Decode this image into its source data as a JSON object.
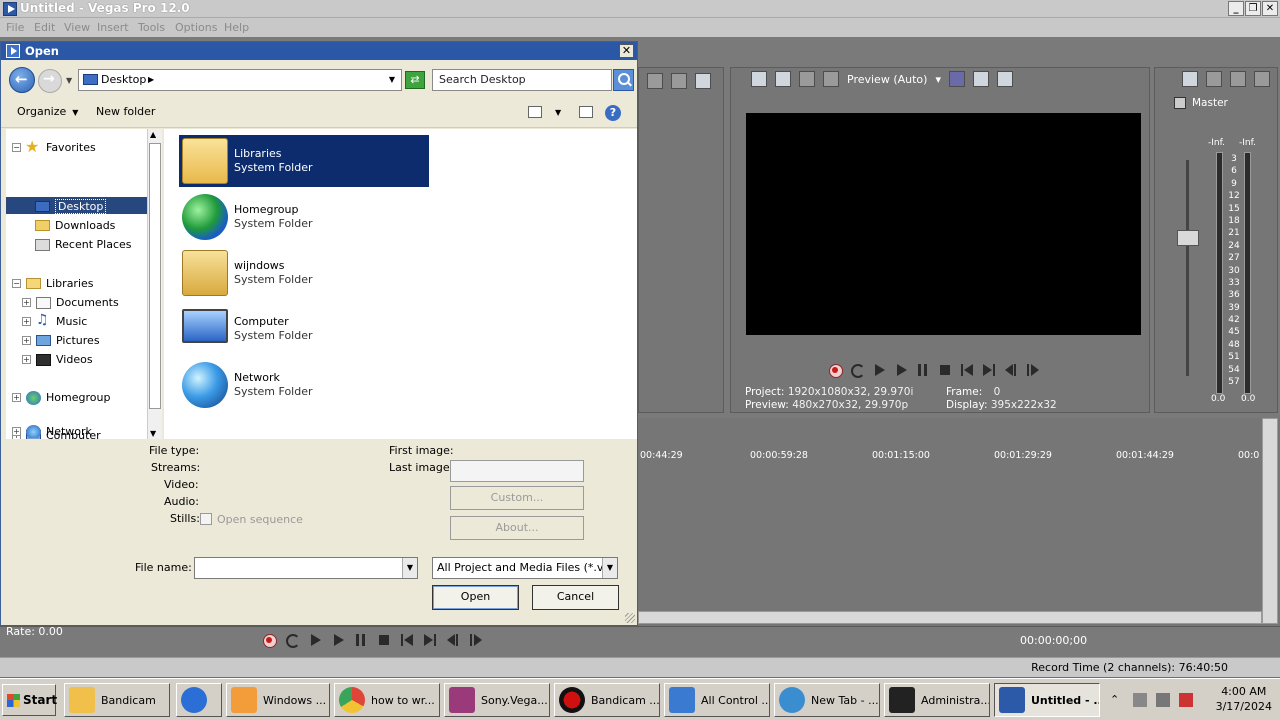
{
  "window": {
    "title": "Untitled - Vegas Pro 12.0"
  },
  "menu": [
    "File",
    "Edit",
    "View",
    "Insert",
    "Tools",
    "Options",
    "Help"
  ],
  "dialog": {
    "title": "Open",
    "address": "Desktop",
    "search_placeholder": "Search Desktop",
    "organize": "Organize",
    "new_folder": "New folder",
    "nav_tree": {
      "favorites": "Favorites",
      "desktop": "Desktop",
      "downloads": "Downloads",
      "recent_places": "Recent Places",
      "libraries": "Libraries",
      "documents": "Documents",
      "music": "Music",
      "pictures": "Pictures",
      "videos": "Videos",
      "homegroup": "Homegroup",
      "computer": "Computer",
      "network": "Network"
    },
    "items": [
      {
        "name": "Libraries",
        "type": "System Folder"
      },
      {
        "name": "Homegroup",
        "type": "System Folder"
      },
      {
        "name": "wijndows",
        "type": "System Folder"
      },
      {
        "name": "Computer",
        "type": "System Folder"
      },
      {
        "name": "Network",
        "type": "System Folder"
      }
    ],
    "details": {
      "file_type": "File type:",
      "streams": "Streams:",
      "video": "Video:",
      "audio": "Audio:",
      "stills": "Stills:",
      "open_sequence": "Open sequence",
      "first_image": "First image:",
      "last_image": "Last image:",
      "custom": "Custom...",
      "about": "About..."
    },
    "file_name_label": "File name:",
    "file_name_value": "",
    "filter": "All Project and Media Files (*.veg",
    "open_button": "Open",
    "cancel_button": "Cancel"
  },
  "preview": {
    "mode": "Preview (Auto)",
    "project_label": "Project:",
    "project_value": "1920x1080x32, 29.970i",
    "preview_label": "Preview:",
    "preview_value": "480x270x32, 29.970p",
    "frame_label": "Frame:",
    "frame_value": "0",
    "display_label": "Display:",
    "display_value": "395x222x32"
  },
  "master": {
    "label": "Master",
    "left_peak": "-Inf.",
    "right_peak": "-Inf.",
    "scale": [
      "3",
      "6",
      "9",
      "12",
      "15",
      "18",
      "21",
      "24",
      "27",
      "30",
      "33",
      "36",
      "39",
      "42",
      "45",
      "48",
      "51",
      "54",
      "57"
    ],
    "left_bottom": "0.0",
    "right_bottom": "0.0"
  },
  "timeline": {
    "ticks": [
      "00:44:29",
      "00:00:59:28",
      "00:01:15:00",
      "00:01:29:29",
      "00:01:44:29",
      "00:0"
    ]
  },
  "rate": "Rate: 0.00",
  "timecode": "00:00:00;00",
  "record_time": "Record Time (2 channels): 76:40:50",
  "taskbar": {
    "start": "Start",
    "tasks": [
      {
        "label": "Bandicam",
        "color": "#f0c04a"
      },
      {
        "label": "",
        "color": "#2a6ed6"
      },
      {
        "label": "Windows ...",
        "color": "#f39c3a"
      },
      {
        "label": "how to wr...",
        "color": "#de4638"
      },
      {
        "label": "Sony.Vega...",
        "color": "#9a3a7a"
      },
      {
        "label": "Bandicam ...",
        "color": "#111111"
      },
      {
        "label": "All Control ...",
        "color": "#3a7ad0"
      },
      {
        "label": "New Tab - ...",
        "color": "#3a8ed0"
      },
      {
        "label": "Administra...",
        "color": "#222222"
      },
      {
        "label": "Untitled - ...",
        "color": "#2d5aa8"
      }
    ],
    "time": "4:00 AM",
    "date": "3/17/2024"
  }
}
